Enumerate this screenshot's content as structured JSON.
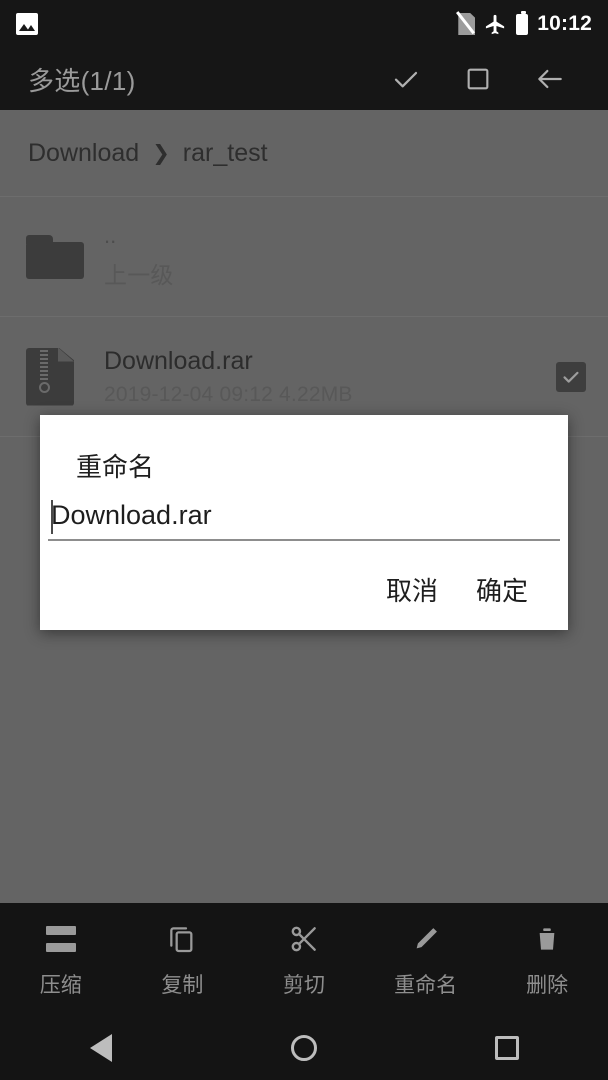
{
  "status_bar": {
    "notification_icon": "photo-icon",
    "sim_icon": "no-sim-icon",
    "airplane_icon": "airplane-mode-icon",
    "battery_icon": "battery-icon",
    "clock": "10:12"
  },
  "action_bar": {
    "title": "多选(1/1)",
    "actions": [
      {
        "name": "confirm-selection-button",
        "icon": "check-icon"
      },
      {
        "name": "select-all-button",
        "icon": "square-icon"
      },
      {
        "name": "back-button",
        "icon": "arrow-left-icon"
      }
    ]
  },
  "breadcrumb": {
    "root": "Download",
    "separator": "❯",
    "current": "rar_test"
  },
  "file_list": [
    {
      "icon": "folder-icon",
      "name": "..",
      "subtitle": "上一级",
      "checked": false
    },
    {
      "icon": "archive-icon",
      "name": "Download.rar",
      "subtitle": "2019-12-04 09:12  4.22MB",
      "checked": true
    }
  ],
  "dialog": {
    "title": "重命名",
    "input_value": "Download.rar",
    "input_placeholder": "",
    "cancel_label": "取消",
    "confirm_label": "确定"
  },
  "bottom_toolbar": [
    {
      "label": "压缩",
      "icon": "compress-icon"
    },
    {
      "label": "复制",
      "icon": "copy-icon"
    },
    {
      "label": "剪切",
      "icon": "scissors-icon"
    },
    {
      "label": "重命名",
      "icon": "pencil-icon"
    },
    {
      "label": "删除",
      "icon": "trash-icon"
    }
  ],
  "nav_bar": [
    {
      "name": "nav-back-button",
      "icon": "triangle-back-icon"
    },
    {
      "name": "nav-home-button",
      "icon": "circle-home-icon"
    },
    {
      "name": "nav-recents-button",
      "icon": "square-recents-icon"
    }
  ],
  "colors": {
    "status_bar_bg": "#161616",
    "action_bar_bg": "#161616",
    "scrim": "#646464",
    "dialog_bg": "#ffffff",
    "toolbar_bg": "#141414",
    "accent_text": "#9a9a9a"
  }
}
